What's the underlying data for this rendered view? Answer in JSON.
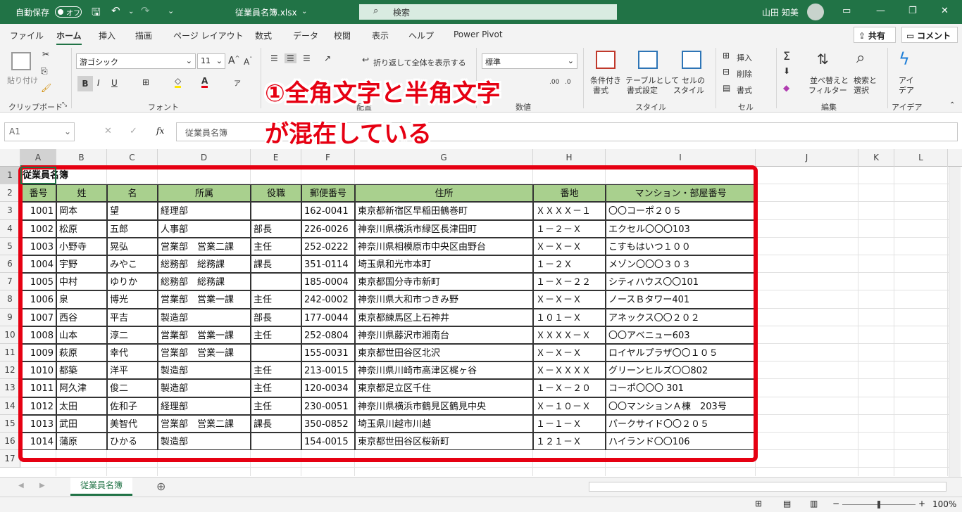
{
  "titlebar": {
    "autosave_label": "自動保存",
    "autosave_state": "オフ",
    "filename": "従業員名簿.xlsx",
    "search_placeholder": "検索",
    "user_name": "山田 知美"
  },
  "menu": [
    "ファイル",
    "ホーム",
    "挿入",
    "描画",
    "ページ レイアウト",
    "数式",
    "データ",
    "校閲",
    "表示",
    "ヘルプ",
    "Power Pivot"
  ],
  "menu_active": "ホーム",
  "share_label": "共有",
  "comment_label": "コメント",
  "ribbon": {
    "paste_label": "貼り付け",
    "clipboard_group": "クリップボード",
    "font_name": "游ゴシック",
    "font_size": "11",
    "font_group": "フォント",
    "wrap_label": "折り返して全体を表示する",
    "alignment_group": "配置",
    "number_format": "標準",
    "number_group": "数値",
    "cond_format_label_1": "条件付き",
    "cond_format_label_2": "書式",
    "table_format_label_1": "テーブルとして",
    "table_format_label_2": "書式設定",
    "cell_style_label_1": "セルの",
    "cell_style_label_2": "スタイル",
    "style_group": "スタイル",
    "insert_label": "挿入",
    "delete_label": "削除",
    "format_label": "書式",
    "cells_group": "セル",
    "sort_label_1": "並べ替えと",
    "sort_label_2": "フィルター",
    "find_label_1": "検索と",
    "find_label_2": "選択",
    "edit_group": "編集",
    "ideas_label_1": "アイ",
    "ideas_label_2": "デア",
    "ideas_group": "アイデア"
  },
  "formula_bar": {
    "name_box": "A1",
    "fx_label": "fx",
    "content": "従業員名簿"
  },
  "annotation": {
    "line1": "①全角文字と半角文字",
    "line2": "が混在している"
  },
  "columns": [
    "A",
    "B",
    "C",
    "D",
    "E",
    "F",
    "G",
    "H",
    "I",
    "J",
    "K",
    "L"
  ],
  "rows": [
    "1",
    "2",
    "3",
    "4",
    "5",
    "6",
    "7",
    "8",
    "9",
    "10",
    "11",
    "12",
    "13",
    "14",
    "15",
    "16",
    "17"
  ],
  "sheet": {
    "title": "従業員名簿",
    "headers": [
      "番号",
      "姓",
      "名",
      "所属",
      "役職",
      "郵便番号",
      "住所",
      "番地",
      "マンション・部屋番号"
    ],
    "records": [
      [
        "1001",
        "岡本",
        "望",
        "経理部",
        "",
        "162-0041",
        "東京都新宿区早稲田鶴巻町",
        "ＸＸＸＸ－１",
        "〇〇コーポ２０５"
      ],
      [
        "1002",
        "松原",
        "五郎",
        "人事部",
        "部長",
        "226-0026",
        "神奈川県横浜市緑区長津田町",
        "１－２－Ｘ",
        "エクセル〇〇〇103"
      ],
      [
        "1003",
        "小野寺",
        "晃弘",
        "営業部　営業二課",
        "主任",
        "252-0222",
        "神奈川県相模原市中央区由野台",
        "Ｘ－Ｘ－Ｘ",
        "こすもはいつ１００"
      ],
      [
        "1004",
        "宇野",
        "みやこ",
        "総務部　総務課",
        "課長",
        "351-0114",
        "埼玉県和光市本町",
        "１－２Ｘ",
        "メゾン〇〇〇３０３"
      ],
      [
        "1005",
        "中村",
        "ゆりか",
        "総務部　総務課",
        "",
        "185-0004",
        "東京都国分寺市新町",
        "１－Ｘ－２２",
        "シティハウス〇〇101"
      ],
      [
        "1006",
        "泉",
        "博光",
        "営業部　営業一課",
        "主任",
        "242-0002",
        "神奈川県大和市つきみ野",
        "Ｘ－Ｘ－Ｘ",
        "ノースＢタワー401"
      ],
      [
        "1007",
        "西谷",
        "平吉",
        "製造部",
        "部長",
        "177-0044",
        "東京都練馬区上石神井",
        "１０１－Ｘ",
        "アネックス〇〇２０２"
      ],
      [
        "1008",
        "山本",
        "淳二",
        "営業部　営業一課",
        "主任",
        "252-0804",
        "神奈川県藤沢市湘南台",
        "ＸＸＸＸ－Ｘ",
        "〇〇アベニュー603"
      ],
      [
        "1009",
        "萩原",
        "幸代",
        "営業部　営業一課",
        "",
        "155-0031",
        "東京都世田谷区北沢",
        "Ｘ－Ｘ－Ｘ",
        "ロイヤルプラザ〇〇１０５"
      ],
      [
        "1010",
        "都築",
        "洋平",
        "製造部",
        "主任",
        "213-0015",
        "神奈川県川崎市高津区梶ヶ谷",
        "Ｘ－ＸＸＸＸ",
        "グリーンヒルズ〇〇802"
      ],
      [
        "1011",
        "阿久津",
        "俊二",
        "製造部",
        "主任",
        "120-0034",
        "東京都足立区千住",
        "１－Ｘ－２０",
        "コーポ〇〇〇 301"
      ],
      [
        "1012",
        "太田",
        "佐和子",
        "経理部",
        "主任",
        "230-0051",
        "神奈川県横浜市鶴見区鶴見中央",
        "Ｘ－１０－Ｘ",
        "〇〇マンションＡ棟　203号"
      ],
      [
        "1013",
        "武田",
        "美智代",
        "営業部　営業二課",
        "課長",
        "350-0852",
        "埼玉県川越市川越",
        "１－１－Ｘ",
        "パークサイド〇〇２０５"
      ],
      [
        "1014",
        "蒲原",
        "ひかる",
        "製造部",
        "",
        "154-0015",
        "東京都世田谷区桜新町",
        "１２１－Ｘ",
        "ハイランド〇〇106"
      ]
    ]
  },
  "sheet_tab": "従業員名簿",
  "zoom": "100%",
  "colors": {
    "accent": "#217346",
    "header_fill": "#a9d08e",
    "annotation": "#e60012"
  }
}
